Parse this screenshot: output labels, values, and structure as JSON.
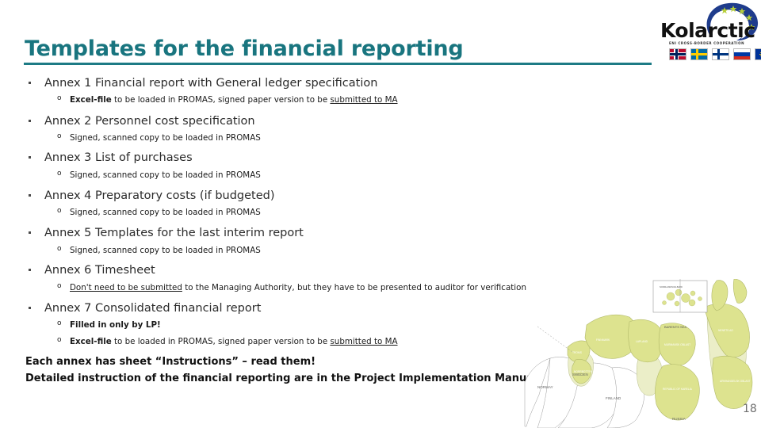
{
  "logo": {
    "wordmark": "Kolarctic",
    "tagline": "ENI CROSS-BORDER COOPERATION",
    "flags": [
      "norway-flag",
      "sweden-flag",
      "finland-flag",
      "russia-flag",
      "eu-flag"
    ]
  },
  "title": "Templates for the financial reporting",
  "accent_color": "#19757f",
  "items": [
    {
      "label": "Annex 1 Financial report with General ledger specification",
      "sub": [
        {
          "bold_prefix": "Excel-file",
          "text": " to be loaded in PROMAS, signed paper version to be ",
          "underline": "submitted to MA"
        }
      ]
    },
    {
      "label": "Annex 2 Personnel cost specification",
      "sub": [
        {
          "bold_prefix": "",
          "text": "Signed, scanned copy to be loaded in PROMAS",
          "underline": ""
        }
      ]
    },
    {
      "label": "Annex 3 List of purchases",
      "sub": [
        {
          "bold_prefix": "",
          "text": "Signed, scanned copy to be loaded in PROMAS",
          "underline": ""
        }
      ]
    },
    {
      "label": "Annex 4 Preparatory costs (if budgeted)",
      "sub": [
        {
          "bold_prefix": "",
          "text": "Signed, scanned copy to be loaded in PROMAS",
          "underline": ""
        }
      ]
    },
    {
      "label": "Annex 5 Templates for the last interim report",
      "sub": [
        {
          "bold_prefix": "",
          "text": "Signed, scanned copy to be loaded in PROMAS",
          "underline": ""
        }
      ]
    },
    {
      "label": "Annex 6 Timesheet",
      "sub": [
        {
          "bold_prefix": "",
          "underline_lead": "Don't need to be submitted",
          "text": " to the Managing Authority, but they have to be presented to auditor for verification",
          "underline": ""
        }
      ]
    },
    {
      "label": "Annex 7 Consolidated financial report",
      "sub": [
        {
          "bold_prefix": "Filled in only by LP!",
          "text": "",
          "underline": ""
        },
        {
          "bold_prefix": "Excel-file",
          "text": " to be loaded in PROMAS, signed paper version to be ",
          "underline": "submitted to MA"
        }
      ]
    }
  ],
  "footer": {
    "line1": "Each annex has sheet “Instructions” – read them!",
    "line2": "Detailed instruction of the financial reporting are in the Project Implementation Manual"
  },
  "map": {
    "inset_label": "NORDLAND/SVALBARD",
    "sea_label": "BARENTS SEA",
    "country_labels": [
      "NORWAY",
      "SWEDEN",
      "FINLAND",
      "RUSSIA"
    ],
    "region_labels": [
      "FINNMARK",
      "LAPLAND",
      "MURMANSK OBLAST",
      "NENETS AO",
      "ARKHANGELSK OBLAST",
      "TROMS",
      "NORRBOTTEN",
      "REPUBLIC OF KARELIA"
    ],
    "land_color": "#dde38f",
    "land_color_light": "#ebeec8"
  },
  "page_number": "18"
}
